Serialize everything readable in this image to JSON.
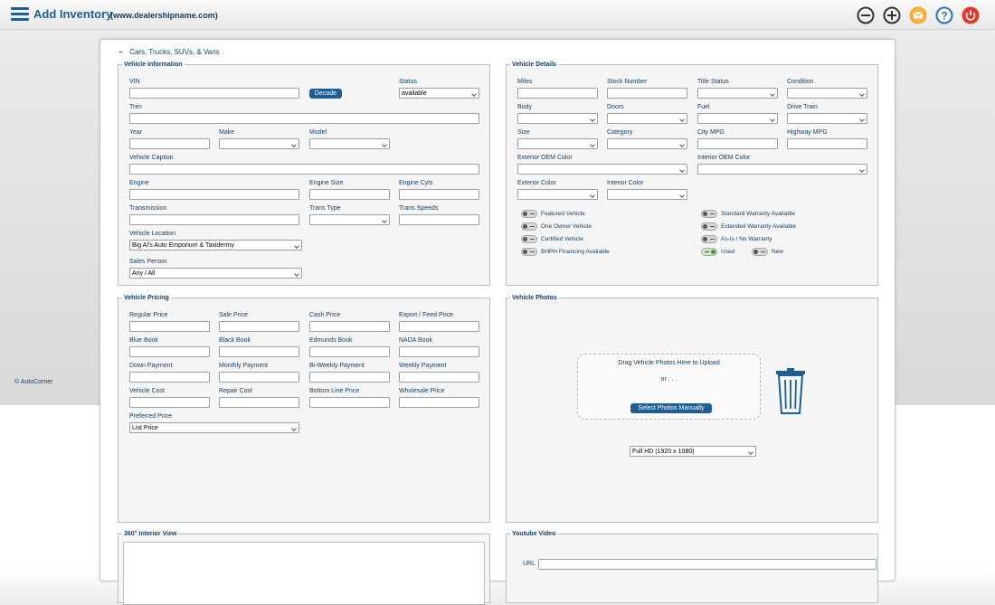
{
  "header": {
    "title": "Add Inventory",
    "subtitle": "(www.dealershipname.com)"
  },
  "footer": {
    "copyright": "© AutoCorner"
  },
  "section": {
    "toggle": "−",
    "title": "Cars, Trucks, SUVs, & Vans"
  },
  "vehicle_info": {
    "legend": "Vehicle Information",
    "vin": "VIN",
    "decode": "Decode",
    "status": "Status",
    "status_value": "available",
    "trim": "Trim",
    "year": "Year",
    "make": "Make",
    "model": "Model",
    "caption": "Vehicle Caption",
    "engine": "Engine",
    "engine_size": "Engine Size",
    "engine_cyls": "Engine Cyls",
    "transmission": "Transmission",
    "trans_type": "Trans Type",
    "trans_speeds": "Trans Speeds",
    "location": "Vehicle Location",
    "location_value": "Big Al's Auto Emporium & Taxidermy",
    "sales_person": "Sales Person",
    "sales_person_value": "Any / All"
  },
  "vehicle_details": {
    "legend": "Vehicle Details",
    "miles": "Miles",
    "stock": "Stock Number",
    "title_status": "Title Status",
    "condition": "Condition",
    "body": "Body",
    "doors": "Doors",
    "fuel": "Fuel",
    "drive_train": "Drive Train",
    "size": "Size",
    "category": "Category",
    "city_mpg": "City MPG",
    "highway_mpg": "Highway MPG",
    "ext_oem": "Exterior OEM Color",
    "int_oem": "Interior OEM Color",
    "ext_color": "Exterior Color",
    "int_color": "Interior Color",
    "toggles": {
      "featured": "Featured Vehicle",
      "one_owner": "One Owner Vehicle",
      "certified": "Certified Vehicle",
      "bhph": "BHPH Financing Available",
      "std_warranty": "Standard Warranty Available",
      "ext_warranty": "Extended Warranty Available",
      "as_is": "As-Is / No Warranty",
      "used": "Used",
      "new": "New"
    }
  },
  "pricing": {
    "legend": "Vehicle Pricing",
    "regular": "Regular Price",
    "sale": "Sale Price",
    "cash": "Cash Price",
    "export": "Export / Feed Price",
    "blue_book": "Blue Book",
    "black_book": "Black Book",
    "edmunds": "Edmunds Book",
    "nada": "NADA Book",
    "down": "Down Payment",
    "monthly": "Monthly Payment",
    "biweekly": "Bi-Weekly Payment",
    "weekly": "Weekly Payment",
    "cost": "Vehicle Cost",
    "repair": "Repair Cost",
    "bottom_line": "Bottom Line Price",
    "wholesale": "Wholesale Price",
    "preferred": "Preferred Price",
    "preferred_value": "List Price"
  },
  "photos": {
    "legend": "Vehicle Photos",
    "drag": "Drag Vehicle Photos Here to Upload",
    "or": "or . . .",
    "select": "Select Photos Manually",
    "resolution": "Full HD (1920 x 1080)"
  },
  "interior": {
    "legend": "360° Interior View"
  },
  "youtube": {
    "legend": "Youtube Video",
    "url": "URL"
  }
}
